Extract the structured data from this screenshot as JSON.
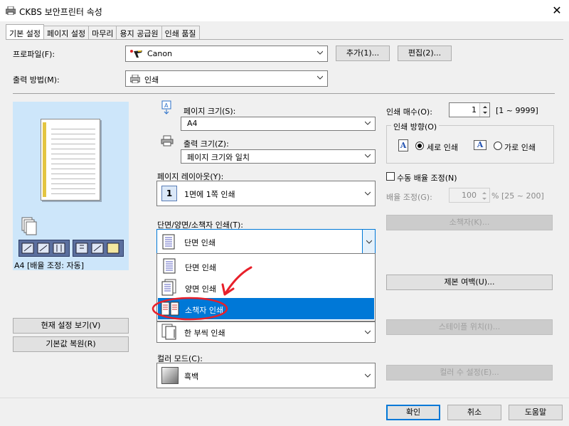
{
  "window": {
    "title": "CKBS 보안프린터 속성",
    "close": "✕"
  },
  "tabs": [
    "기본 설정",
    "페이지 설정",
    "마무리",
    "용지 공급원",
    "인쇄 품질"
  ],
  "profile": {
    "label": "프로파일(F):",
    "value": "Canon",
    "add": "추가(1)...",
    "edit": "편집(2)..."
  },
  "output": {
    "label": "출력 방법(M):",
    "value": "인쇄"
  },
  "preview": {
    "caption": "A4 [배율 조정: 자동]"
  },
  "page_size": {
    "label": "페이지 크기(S):",
    "value": "A4"
  },
  "output_size": {
    "label": "출력 크기(Z):",
    "value": "페이지 크기와 일치"
  },
  "layout": {
    "label": "페이지 레이아웃(Y):",
    "value": "1면에 1쪽 인쇄",
    "icon_num": "1"
  },
  "duplex": {
    "label": "단면/양면/소책자 인쇄(T):",
    "value": "단면 인쇄",
    "options": [
      "단면 인쇄",
      "양면 인쇄",
      "소책자 인쇄"
    ],
    "selected_index": 2
  },
  "collate": {
    "value": "한 부씩 인쇄"
  },
  "color_mode": {
    "label": "컬러 모드(C):",
    "value": "흑백"
  },
  "copies": {
    "label": "인쇄 매수(O):",
    "value": "1",
    "range": "[1 ~ 9999]"
  },
  "orientation": {
    "legend": "인쇄 방향(O)",
    "portrait": "세로 인쇄",
    "landscape": "가로 인쇄",
    "selected": "portrait",
    "icon_letter": "A"
  },
  "manual_scale": {
    "label": "수동 배율 조정(N)",
    "checked": false
  },
  "scale": {
    "label": "배율 조정(G):",
    "value": "100",
    "range": "% [25 ~ 200]"
  },
  "buttons": {
    "booklet": "소책자(K)...",
    "binding_margin": "제본 여백(U)...",
    "staple": "스테이플 위치(I)...",
    "color_settings": "컬러 수 설정(E)...",
    "view_settings": "현재 설정 보기(V)",
    "restore": "기본값 복원(R)",
    "ok": "확인",
    "cancel": "취소",
    "help": "도움말"
  },
  "annotation_color": "#e8202a",
  "accent": "#0078d7"
}
